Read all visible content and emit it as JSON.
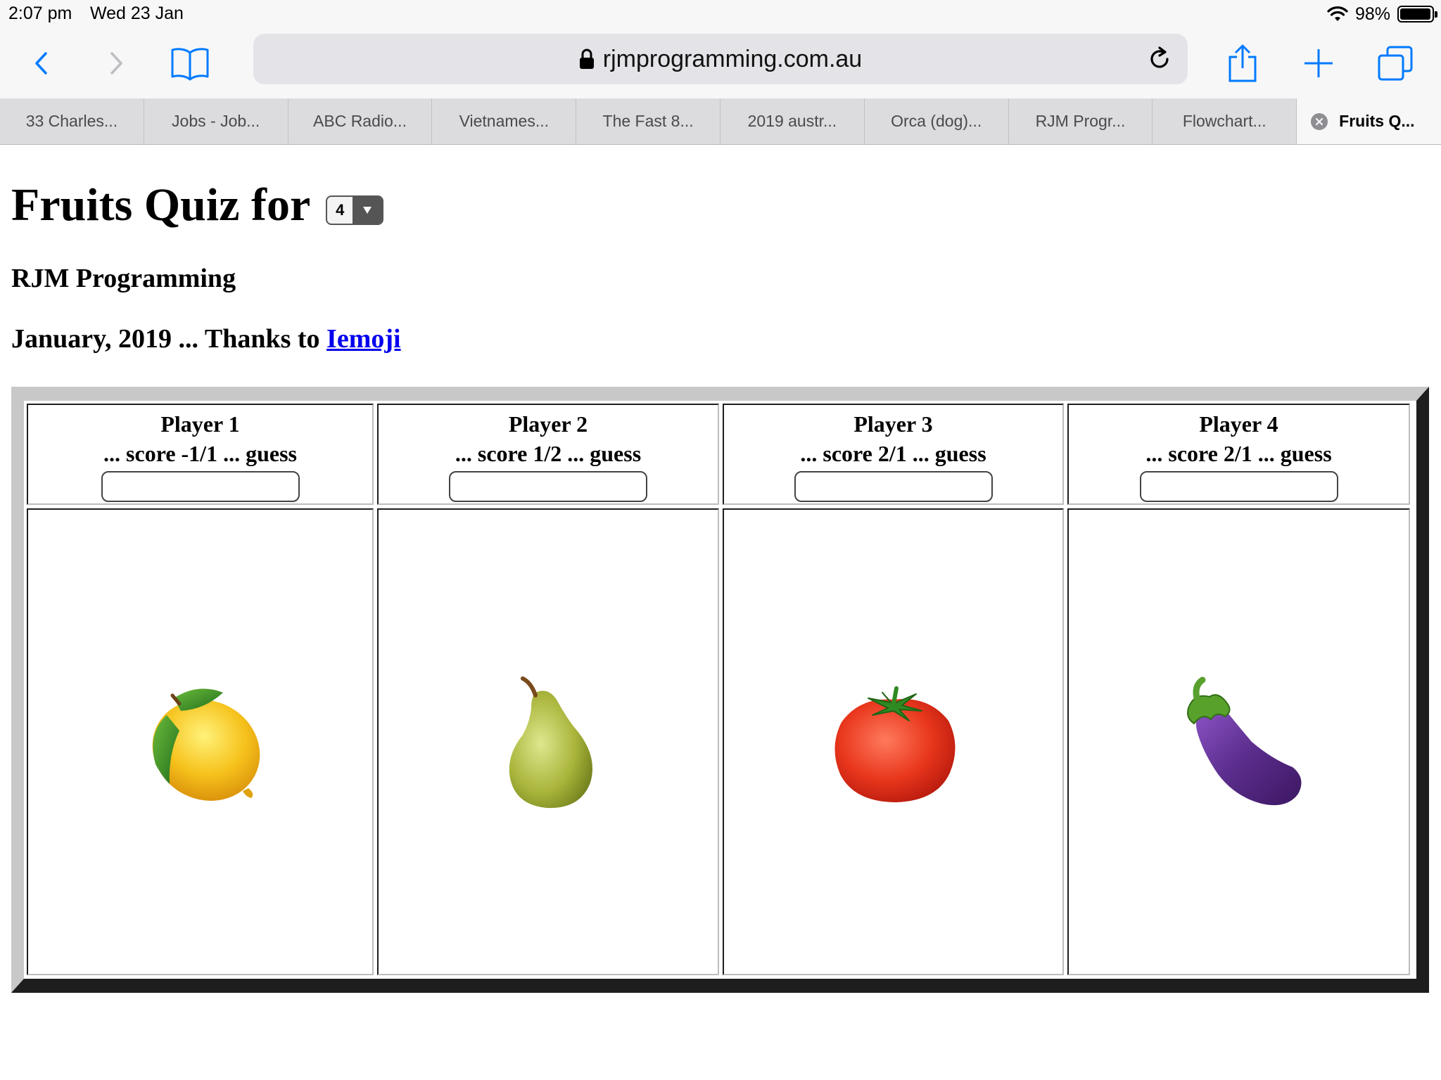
{
  "status": {
    "time": "2:07 pm",
    "date": "Wed 23 Jan",
    "battery": "98%",
    "battery_fraction": 0.98
  },
  "browser": {
    "url": "rjmprogramming.com.au",
    "icons": {
      "back": "chevron-left-icon",
      "forward": "chevron-right-icon",
      "bookmarks": "book-icon",
      "secure": "lock-icon",
      "reload": "reload-icon",
      "share": "share-icon",
      "new_tab": "plus-icon",
      "tabs": "tabs-icon"
    },
    "tabs": [
      {
        "label": "33 Charles..."
      },
      {
        "label": "Jobs - Job..."
      },
      {
        "label": "ABC Radio..."
      },
      {
        "label": "Vietnames..."
      },
      {
        "label": "The Fast 8..."
      },
      {
        "label": "2019 austr..."
      },
      {
        "label": "Orca (dog)..."
      },
      {
        "label": "RJM Progr..."
      },
      {
        "label": "Flowchart..."
      },
      {
        "label": "Fruits Q..."
      }
    ],
    "accent_color": "#007aff"
  },
  "page": {
    "title": "Fruits Quiz for",
    "player_count": "4",
    "subtitle": "RJM Programming",
    "credit_prefix": "January, 2019 ... Thanks to",
    "credit_link": "Iemoji",
    "link_color": "#0000ee"
  },
  "players": [
    {
      "name": "Player 1",
      "score_line": "... score -1/1 ... guess",
      "guess": "",
      "fruit": "lemon"
    },
    {
      "name": "Player 2",
      "score_line": "... score 1/2 ... guess",
      "guess": "",
      "fruit": "pear"
    },
    {
      "name": "Player 3",
      "score_line": "... score 2/1 ... guess",
      "guess": "",
      "fruit": "tomato"
    },
    {
      "name": "Player 4",
      "score_line": "... score 2/1 ... guess",
      "guess": "",
      "fruit": "eggplant"
    }
  ]
}
